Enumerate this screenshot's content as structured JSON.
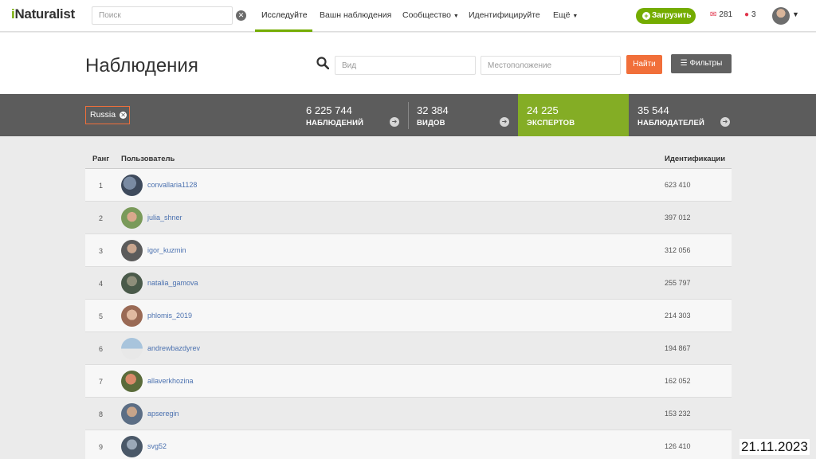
{
  "nav": {
    "logo": "Naturalist",
    "logo_i": "i",
    "search_placeholder": "Поиск",
    "links": [
      "Исследуйте",
      "Вашн наблюдения",
      "Сообщество",
      "Идентифицируйте",
      "Ещё"
    ],
    "upload_label": "Загрузить",
    "messages_count": "281",
    "notifications_count": "3"
  },
  "header": {
    "title": "Наблюдения",
    "taxon_placeholder": "Вид",
    "location_placeholder": "Местоположение",
    "find_label": "Найти",
    "filters_label": "Фильтры"
  },
  "place": "Russia",
  "stats": [
    {
      "value": "6 225 744",
      "label": "НАБЛЮДЕНИЙ"
    },
    {
      "value": "32 384",
      "label": "ВИДОВ"
    },
    {
      "value": "24 225",
      "label": "ЭКСПЕРТОВ"
    },
    {
      "value": "35 544",
      "label": "НАБЛЮДАТЕЛЕЙ"
    }
  ],
  "table": {
    "headers": {
      "rank": "Ранг",
      "user": "Пользователь",
      "ids": "Идентификации"
    },
    "rows": [
      {
        "rank": "1",
        "user": "convallaria1128",
        "ids": "623 410"
      },
      {
        "rank": "2",
        "user": "julia_shner",
        "ids": "397 012"
      },
      {
        "rank": "3",
        "user": "igor_kuzmin",
        "ids": "312 056"
      },
      {
        "rank": "4",
        "user": "natalia_gamova",
        "ids": "255 797"
      },
      {
        "rank": "5",
        "user": "phlomis_2019",
        "ids": "214 303"
      },
      {
        "rank": "6",
        "user": "andrewbazdyrev",
        "ids": "194 867"
      },
      {
        "rank": "7",
        "user": "allaverkhozina",
        "ids": "162 052"
      },
      {
        "rank": "8",
        "user": "apseregin",
        "ids": "153 232"
      },
      {
        "rank": "9",
        "user": "svg52",
        "ids": "126 410"
      }
    ]
  },
  "date": "21.11.2023",
  "colors": {
    "brand_green": "#74ac00",
    "stat_selected": "#84ad25",
    "find_orange": "#f16f3a",
    "stats_bg": "#5c5c5c",
    "link_blue": "#4c72b0"
  }
}
